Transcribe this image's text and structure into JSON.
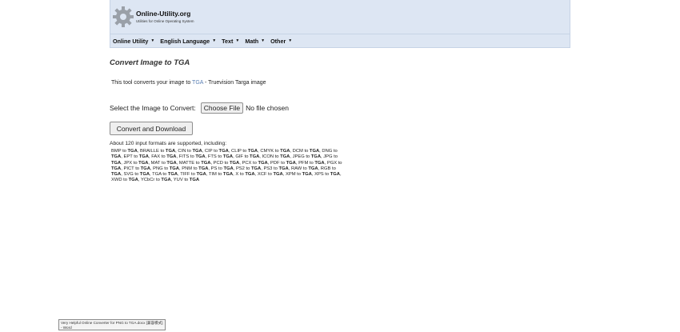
{
  "header": {
    "brand": "Online-Utility.org",
    "tagline": "Utilities for Online Operating System"
  },
  "nav": [
    {
      "label": "Online Utility"
    },
    {
      "label": "English Language"
    },
    {
      "label": "Text"
    },
    {
      "label": "Math"
    },
    {
      "label": "Other"
    }
  ],
  "main": {
    "title": "Convert Image to TGA",
    "intro_prefix": "This tool converts your image to",
    "intro_link": "TGA",
    "intro_suffix": "- Truevision Targa image",
    "select_label": "Select the Image to Convert:",
    "file_button": "Choose File",
    "file_status": "No file chosen",
    "convert_button": "Convert and Download",
    "formats_heading": "About 120 input formats are supported, including:",
    "target": "TGA",
    "formats": [
      "BMP",
      "BRAILLE",
      "CIN",
      "CIP",
      "CLIP",
      "CMYK",
      "DCM",
      "DNG",
      "EPT",
      "FAX",
      "FITS",
      "FTS",
      "GIF",
      "ICON",
      "JPEG",
      "JPG",
      "JPX",
      "MAT",
      "MATTE",
      "PCD",
      "PCX",
      "PDF",
      "PFM",
      "PGX",
      "PICT",
      "PNG",
      "PNM",
      "PS",
      "PS2",
      "PS3",
      "RAW",
      "RGB",
      "SVG",
      "TGA",
      "TIFF",
      "TIM",
      "X",
      "XCF",
      "XPM",
      "XPS",
      "XWD",
      "YCbCr",
      "YUV"
    ]
  },
  "taskbar": {
    "tooltip": "Very Helpful Online Converter for PNG to TGA.docx [兼容模式] - Word"
  }
}
